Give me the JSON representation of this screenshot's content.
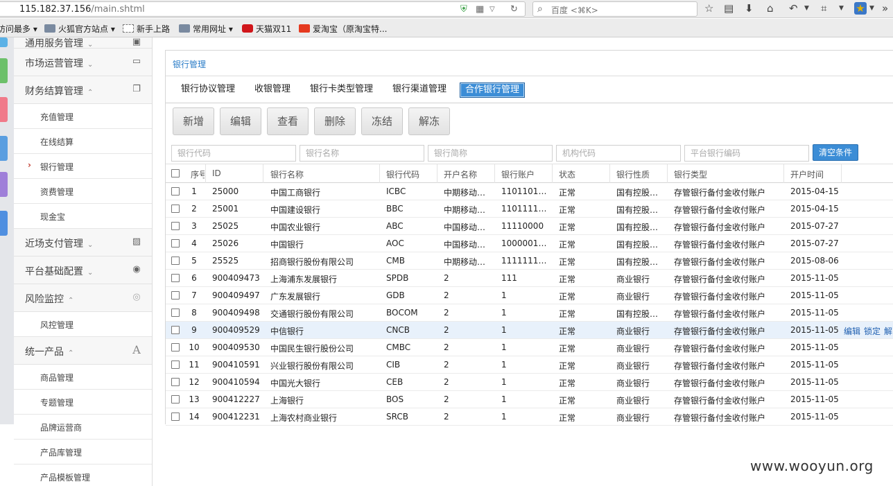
{
  "browser": {
    "url_host": "115.182.37.156",
    "url_path": "/main.shtml",
    "search_placeholder": "百度 <⌘K>"
  },
  "bookmarks": [
    {
      "label": "访问最多",
      "icon": "none"
    },
    {
      "label": "火狐官方站点",
      "icon": "folder-icon"
    },
    {
      "label": "新手上路",
      "icon": "dashed-icon"
    },
    {
      "label": "常用网址",
      "icon": "folder-icon"
    },
    {
      "label": "天猫双11",
      "icon": "tmall-icon"
    },
    {
      "label": "爱淘宝（原淘宝特...",
      "icon": "taobao-icon"
    }
  ],
  "sidebar": {
    "sections": [
      {
        "label": "通用服务管理",
        "arrow": "⌄",
        "icon": "layout-icon"
      },
      {
        "label": "市场运营管理",
        "arrow": "⌄",
        "icon": "window-icon"
      },
      {
        "label": "财务结算管理",
        "arrow": "⌃",
        "icon": "copy-icon"
      }
    ],
    "finance_items": [
      "充值管理",
      "在线结算",
      "银行管理",
      "资费管理",
      "现金宝"
    ],
    "sections2": [
      {
        "label": "近场支付管理",
        "arrow": "⌄",
        "icon": "image-icon"
      },
      {
        "label": "平台基础配置",
        "arrow": "⌄",
        "icon": "dashboard-icon"
      },
      {
        "label": "风险监控",
        "arrow": "⌃",
        "icon": "gauge-icon"
      }
    ],
    "risk_items": [
      "风控管理"
    ],
    "section3": {
      "label": "统一产品",
      "arrow": "⌃",
      "icon": "font-icon"
    },
    "product_items": [
      "商品管理",
      "专题管理",
      "品牌运营商",
      "产品库管理",
      "产品模板管理"
    ]
  },
  "breadcrumb": "银行管理",
  "tabs": [
    "银行协议管理",
    "收银管理",
    "银行卡类型管理",
    "银行渠道管理",
    "合作银行管理"
  ],
  "toolbar": [
    "新增",
    "编辑",
    "查看",
    "删除",
    "冻结",
    "解冻"
  ],
  "filters": [
    "银行代码",
    "银行名称",
    "银行简称",
    "机构代码",
    "平台银行编码"
  ],
  "clear_label": "清空条件",
  "columns": [
    "序号",
    "ID",
    "银行名称",
    "银行代码",
    "开户名称",
    "银行账户",
    "状态",
    "银行性质",
    "银行类型",
    "开户时间"
  ],
  "rows": [
    [
      "1",
      "25000",
      "中国工商银行",
      "ICBC",
      "中期移动…",
      "1101101…",
      "正常",
      "国有控股…",
      "存管银行备付金收付账户",
      "2015-04-15"
    ],
    [
      "2",
      "25001",
      "中国建设银行",
      "BBC",
      "中期移动…",
      "1101111…",
      "正常",
      "国有控股…",
      "存管银行备付金收付账户",
      "2015-04-15"
    ],
    [
      "3",
      "25025",
      "中国农业银行",
      "ABC",
      "中国移动…",
      "11110000",
      "正常",
      "国有控股…",
      "存管银行备付金收付账户",
      "2015-07-27"
    ],
    [
      "4",
      "25026",
      "中国银行",
      "AOC",
      "中国移动…",
      "1000001…",
      "正常",
      "国有控股…",
      "存管银行备付金收付账户",
      "2015-07-27"
    ],
    [
      "5",
      "25525",
      "招商银行股份有限公司",
      "CMB",
      "中期移动…",
      "1111111…",
      "正常",
      "国有控股…",
      "存管银行备付金收付账户",
      "2015-08-06"
    ],
    [
      "6",
      "900409473",
      "上海浦东发展银行",
      "SPDB",
      "2",
      "111",
      "正常",
      "商业银行",
      "存管银行备付金收付账户",
      "2015-11-05"
    ],
    [
      "7",
      "900409497",
      "广东发展银行",
      "GDB",
      "2",
      "1",
      "正常",
      "商业银行",
      "存管银行备付金收付账户",
      "2015-11-05"
    ],
    [
      "8",
      "900409498",
      "交通银行股份有限公司",
      "BOCOM",
      "2",
      "1",
      "正常",
      "国有控股…",
      "存管银行备付金收付账户",
      "2015-11-05"
    ],
    [
      "9",
      "900409529",
      "中信银行",
      "CNCB",
      "2",
      "1",
      "正常",
      "商业银行",
      "存管银行备付金收付账户",
      "2015-11-05"
    ],
    [
      "10",
      "900409530",
      "中国民生银行股份公司",
      "CMBC",
      "2",
      "1",
      "正常",
      "商业银行",
      "存管银行备付金收付账户",
      "2015-11-05"
    ],
    [
      "11",
      "900410591",
      "兴业银行股份有限公司",
      "CIB",
      "2",
      "1",
      "正常",
      "商业银行",
      "存管银行备付金收付账户",
      "2015-11-05"
    ],
    [
      "12",
      "900410594",
      "中国光大银行",
      "CEB",
      "2",
      "1",
      "正常",
      "商业银行",
      "存管银行备付金收付账户",
      "2015-11-05"
    ],
    [
      "13",
      "900412227",
      "上海银行",
      "BOS",
      "2",
      "1",
      "正常",
      "商业银行",
      "存管银行备付金收付账户",
      "2015-11-05"
    ],
    [
      "14",
      "900412231",
      "上海农村商业银行",
      "SRCB",
      "2",
      "1",
      "正常",
      "商业银行",
      "存管银行备付金收付账户",
      "2015-11-05"
    ]
  ],
  "row_actions": [
    "编辑",
    "锁定",
    "解"
  ],
  "watermark": "www.wooyun.org",
  "colors": {
    "accent": "#3c8dd6",
    "link": "#2a7cc7",
    "highlight_row": "#e8f1fb"
  }
}
